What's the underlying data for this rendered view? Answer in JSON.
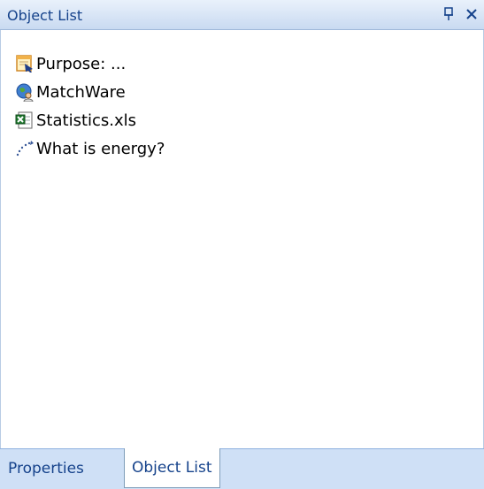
{
  "panel": {
    "title": "Object List",
    "pin_icon": "pin-icon",
    "close_icon": "close-icon"
  },
  "objects": [
    {
      "label": "Purpose: ...",
      "icon": "form-icon"
    },
    {
      "label": "MatchWare",
      "icon": "globe-user-icon"
    },
    {
      "label": "Statistics.xls",
      "icon": "excel-icon"
    },
    {
      "label": "What is energy?",
      "icon": "path-icon"
    }
  ],
  "tabs": {
    "properties": "Properties",
    "object_list": "Object List",
    "active": "Object List"
  },
  "colors": {
    "title_text": "#15428b",
    "titlebar_bg": "#c9daf1",
    "tabbar_bg": "#cfe0f6"
  }
}
